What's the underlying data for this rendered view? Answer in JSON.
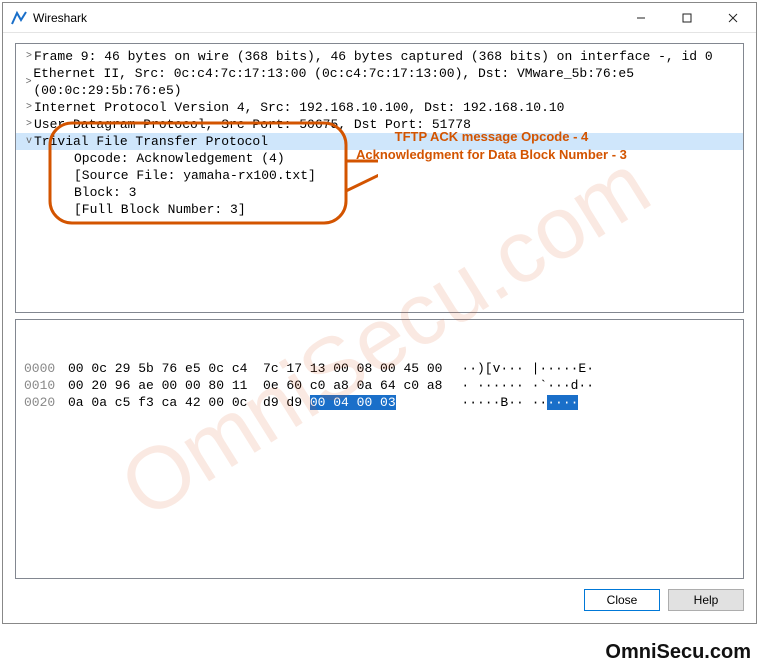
{
  "window": {
    "title": "Wireshark"
  },
  "tree": {
    "rows": [
      {
        "exp": ">",
        "text": "Frame 9: 46 bytes on wire (368 bits), 46 bytes captured (368 bits) on interface -, id 0"
      },
      {
        "exp": ">",
        "text": "Ethernet II, Src: 0c:c4:7c:17:13:00 (0c:c4:7c:17:13:00), Dst: VMware_5b:76:e5 (00:0c:29:5b:76:e5)"
      },
      {
        "exp": ">",
        "text": "Internet Protocol Version 4, Src: 192.168.10.100, Dst: 192.168.10.10"
      },
      {
        "exp": ">",
        "text": "User Datagram Protocol, Src Port: 50675, Dst Port: 51778"
      },
      {
        "exp": "v",
        "text": "Trivial File Transfer Protocol",
        "sel": true
      },
      {
        "exp": "",
        "text": "Opcode: Acknowledgement (4)",
        "indent": 2
      },
      {
        "exp": "",
        "text": "[Source File: yamaha-rx100.txt]",
        "indent": 2
      },
      {
        "exp": "",
        "text": "Block: 3",
        "indent": 2
      },
      {
        "exp": "",
        "text": "[Full Block Number: 3]",
        "indent": 2
      }
    ]
  },
  "hex": {
    "lines": [
      {
        "off": "0000",
        "b1": "00 0c 29 5b 76 e5 0c c4",
        "b2": "7c 17 13 00 08 00 45 00",
        "ascii": "··)[v··· |·····E·"
      },
      {
        "off": "0010",
        "b1": "00 20 96 ae 00 00 80 11",
        "b2": "0e 60 c0 a8 0a 64 c0 a8",
        "ascii": "· ······ ·`···d··"
      },
      {
        "off": "0020",
        "b1": "0a 0a c5 f3 ca 42 00 0c",
        "b2": "d9 d9 ",
        "b2hl": "00 04 00 03",
        "ascii": "·····B·· ··",
        "asciihl": "····"
      }
    ]
  },
  "annotation": {
    "line1": "TFTP ACK message Opcode - 4",
    "line2": "Acknowledgment for Data Block Number - 3"
  },
  "buttons": {
    "close": "Close",
    "help": "Help"
  },
  "watermark": "OmniSecu.com",
  "footer": "OmniSecu.com"
}
